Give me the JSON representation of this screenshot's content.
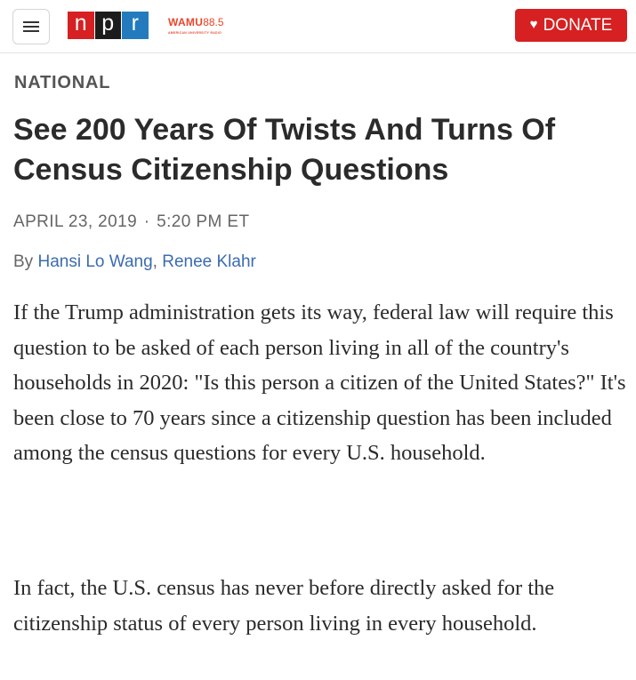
{
  "header": {
    "menu_icon": "hamburger-menu-icon",
    "logo": {
      "letters": [
        "n",
        "p",
        "r"
      ],
      "colors": [
        "#d62021",
        "#1c1c1c",
        "#237bbd"
      ]
    },
    "station": {
      "name": "WAMU",
      "frequency": "88.5",
      "subtitle": "AMERICAN UNIVERSITY RADIO",
      "color": "#e8462a"
    },
    "donate": {
      "icon": "heart-icon",
      "label": "DONATE",
      "color": "#d62021"
    }
  },
  "article": {
    "section": "NATIONAL",
    "headline": "See 200 Years Of Twists And Turns Of Census Citizenship Questions",
    "date": "APRIL 23, 2019",
    "separator": "·",
    "time": "5:20 PM ET",
    "byline_prefix": "By",
    "authors": [
      {
        "name": "Hansi Lo Wang"
      },
      {
        "name": "Renee Klahr"
      }
    ],
    "author_separator": ",",
    "paragraphs": [
      "If the Trump administration gets its way, federal law will require this question to be asked of each person living in all of the country's households in 2020: \"Is this person a citizen of the United States?\" It's been close to 70 years since a citizenship question has been included among the census questions for every U.S. household.",
      "In fact, the U.S. census has never before directly asked for the citizenship status of every person living in every household."
    ],
    "link_color": "#3b6cb0"
  }
}
